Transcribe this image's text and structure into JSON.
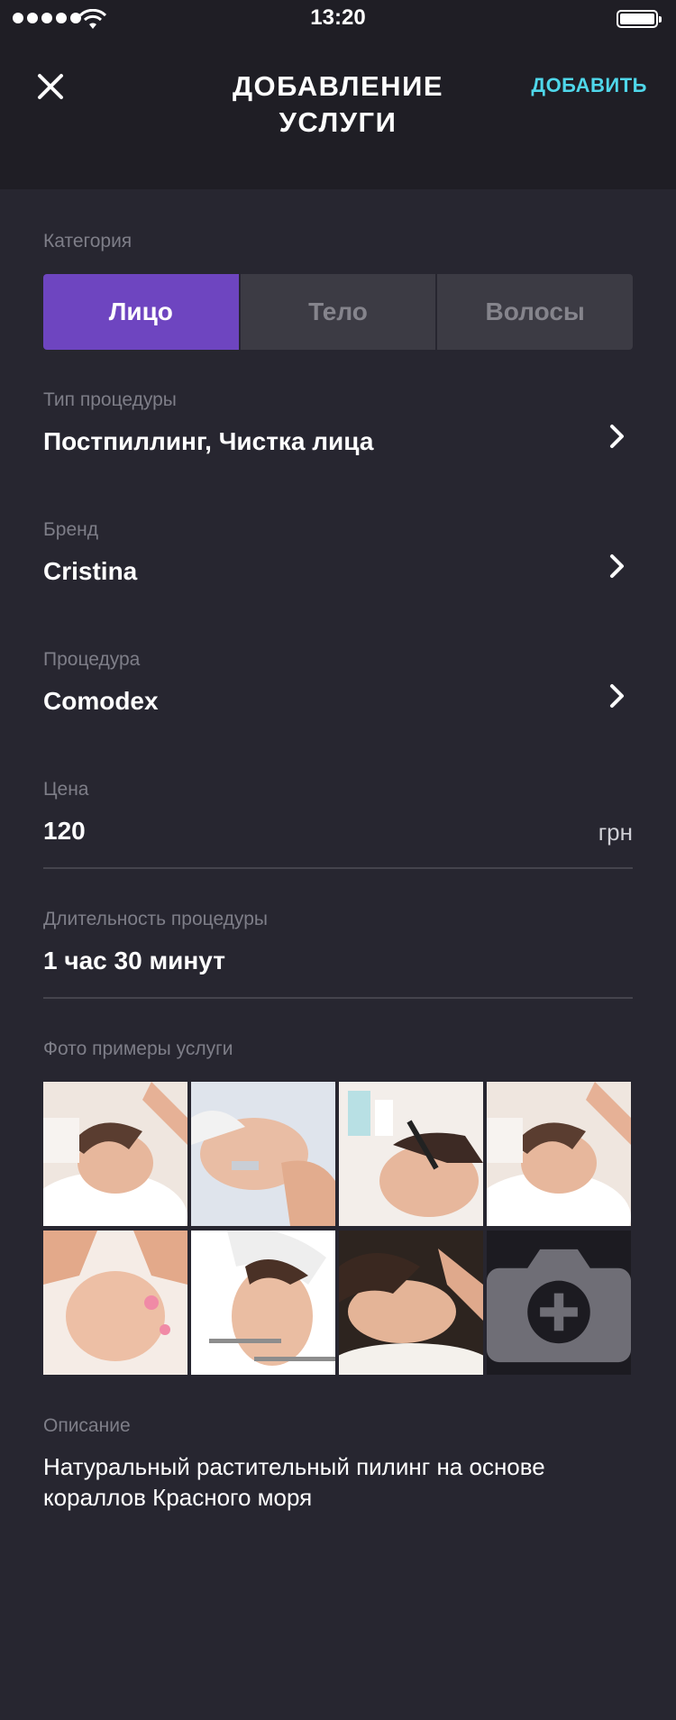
{
  "status": {
    "time": "13:20"
  },
  "header": {
    "title": "ДОБАВЛЕНИЕ УСЛУГИ",
    "add_label": "ДОБАВИТЬ"
  },
  "category": {
    "label": "Категория",
    "options": [
      "Лицо",
      "Тело",
      "Волосы"
    ],
    "selected": "Лицо"
  },
  "procedure_type": {
    "label": "Тип процедуры",
    "value": "Постпиллинг, Чистка лица"
  },
  "brand": {
    "label": "Бренд",
    "value": "Cristina"
  },
  "procedure": {
    "label": "Процедура",
    "value": "Comodex"
  },
  "price": {
    "label": "Цена",
    "value": "120",
    "unit": "грн"
  },
  "duration": {
    "label": "Длительность процедуры",
    "value": "1 час 30 минут"
  },
  "photos": {
    "label": "Фото примеры услуги",
    "items": [
      {
        "icon": "photo-face-spa"
      },
      {
        "icon": "photo-face-ultrasound"
      },
      {
        "icon": "photo-face-device"
      },
      {
        "icon": "photo-face-spa"
      },
      {
        "icon": "photo-face-massage"
      },
      {
        "icon": "photo-face-mask"
      },
      {
        "icon": "photo-face-relax"
      }
    ],
    "add_icon": "camera-plus-icon"
  },
  "description": {
    "label": "Описание",
    "value": "Натуральный растительный пилинг на основе кораллов Красного моря"
  },
  "colors": {
    "accent": "#6e45c0",
    "link": "#4fd7ea",
    "background": "#272630",
    "header": "#1f1e25"
  }
}
